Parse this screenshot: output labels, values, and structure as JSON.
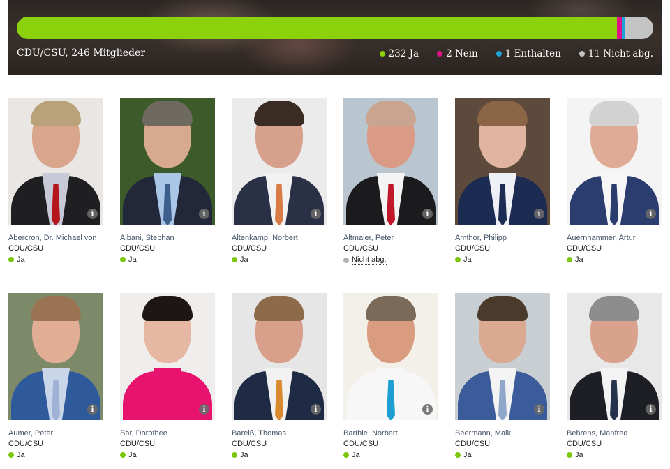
{
  "summary": {
    "party_label": "CDU/CSU, 246 Mitglieder",
    "bar": [
      {
        "key": "ja",
        "fraction": 0.9431,
        "color": "#8cd20a"
      },
      {
        "key": "nein",
        "fraction": 0.0081,
        "color": "#e0128a"
      },
      {
        "key": "enthalten",
        "fraction": 0.0041,
        "color": "#1ca4d8"
      },
      {
        "key": "nicht_abg",
        "fraction": 0.0447,
        "color": "#c4c4c4"
      }
    ],
    "legend": [
      {
        "label": "232 Ja",
        "color": "#8cd20a"
      },
      {
        "label": "2 Nein",
        "color": "#e0128a"
      },
      {
        "label": "1 Enthalten",
        "color": "#1ca4d8"
      },
      {
        "label": "11 Nicht abg.",
        "color": "#c4c4c4"
      }
    ]
  },
  "members": [
    {
      "name": "Abercron, Dr. Michael von",
      "party": "CDU/CSU",
      "vote": "Ja",
      "vote_color": "#7ac70c",
      "photo": {
        "bg": "#e9e6e3",
        "skin": "#d9a58d",
        "hair": "#b9a27a",
        "suit": "#1f1f22",
        "shirt": "#c8c9d6",
        "tie": "#b5161b"
      }
    },
    {
      "name": "Albani, Stephan",
      "party": "CDU/CSU",
      "vote": "Ja",
      "vote_color": "#7ac70c",
      "photo": {
        "bg": "#3d5a2a",
        "skin": "#d7a98f",
        "hair": "#6f6a60",
        "suit": "#22283a",
        "shirt": "#a9c6e6",
        "tie": "#3e5f8c"
      }
    },
    {
      "name": "Altenkamp, Norbert",
      "party": "CDU/CSU",
      "vote": "Ja",
      "vote_color": "#7ac70c",
      "photo": {
        "bg": "#ebebeb",
        "skin": "#d7a08c",
        "hair": "#3a2c22",
        "suit": "#2a3046",
        "shirt": "#f2f2f2",
        "tie": "#d97b45"
      }
    },
    {
      "name": "Altmaier, Peter",
      "party": "CDU/CSU",
      "vote": "Nicht abg.",
      "vote_color": "#b0b0b0",
      "photo": {
        "bg": "#b9c6d0",
        "skin": "#d99b86",
        "hair": "#c9a591",
        "suit": "#1b1b1d",
        "shirt": "#f4f4f4",
        "tie": "#c0182a"
      }
    },
    {
      "name": "Amthor, Philipp",
      "party": "CDU/CSU",
      "vote": "Ja",
      "vote_color": "#7ac70c",
      "photo": {
        "bg": "#5e4a3c",
        "skin": "#e0b4a0",
        "hair": "#8a6546",
        "suit": "#1c2b52",
        "shirt": "#eef0f5",
        "tie": "#1c2b52"
      }
    },
    {
      "name": "Auernhammer, Artur",
      "party": "CDU/CSU",
      "vote": "Ja",
      "vote_color": "#7ac70c",
      "photo": {
        "bg": "#f4f4f4",
        "skin": "#e0ab96",
        "hair": "#d2d2d2",
        "suit": "#2b3d6e",
        "shirt": "#f6f6f6",
        "tie": "#2b3d6e"
      }
    },
    {
      "name": "Aumer, Peter",
      "party": "CDU/CSU",
      "vote": "Ja",
      "vote_color": "#7ac70c",
      "photo": {
        "bg": "#7d8a6a",
        "skin": "#e1ad95",
        "hair": "#9a7452",
        "suit": "#2e5a9c",
        "shirt": "#c9d6ea",
        "tie": "#9fb2d6"
      }
    },
    {
      "name": "Bär, Dorothee",
      "party": "CDU/CSU",
      "vote": "Ja",
      "vote_color": "#7ac70c",
      "photo": {
        "bg": "#efeeec",
        "skin": "#e6b8a4",
        "hair": "#1e1614",
        "suit": "#e8136f",
        "shirt": "#e8136f",
        "tie": "#e8136f"
      }
    },
    {
      "name": "Bareiß, Thomas",
      "party": "CDU/CSU",
      "vote": "Ja",
      "vote_color": "#7ac70c",
      "photo": {
        "bg": "#e6e6e6",
        "skin": "#d8a08a",
        "hair": "#8c6a4a",
        "suit": "#1f2a44",
        "shirt": "#f1f1f1",
        "tie": "#d98a2e"
      }
    },
    {
      "name": "Barthle, Norbert",
      "party": "CDU/CSU",
      "vote": "Ja",
      "vote_color": "#7ac70c",
      "photo": {
        "bg": "#f3f0ea",
        "skin": "#d99c7e",
        "hair": "#7b6a58",
        "suit": "#f7f7f7",
        "shirt": "#f7f7f7",
        "tie": "#1e9fd4"
      }
    },
    {
      "name": "Beermann, Maik",
      "party": "CDU/CSU",
      "vote": "Ja",
      "vote_color": "#7ac70c",
      "photo": {
        "bg": "#c9ced2",
        "skin": "#dba892",
        "hair": "#4a3a2c",
        "suit": "#3b5b9a",
        "shirt": "#f3f3f3",
        "tie": "#8fa7c9"
      }
    },
    {
      "name": "Behrens, Manfred",
      "party": "CDU/CSU",
      "vote": "Ja",
      "vote_color": "#7ac70c",
      "photo": {
        "bg": "#e8e8e8",
        "skin": "#d8a28d",
        "hair": "#8d8d8d",
        "suit": "#1d1f25",
        "shirt": "#f3f3f3",
        "tie": "#26314d"
      }
    }
  ]
}
